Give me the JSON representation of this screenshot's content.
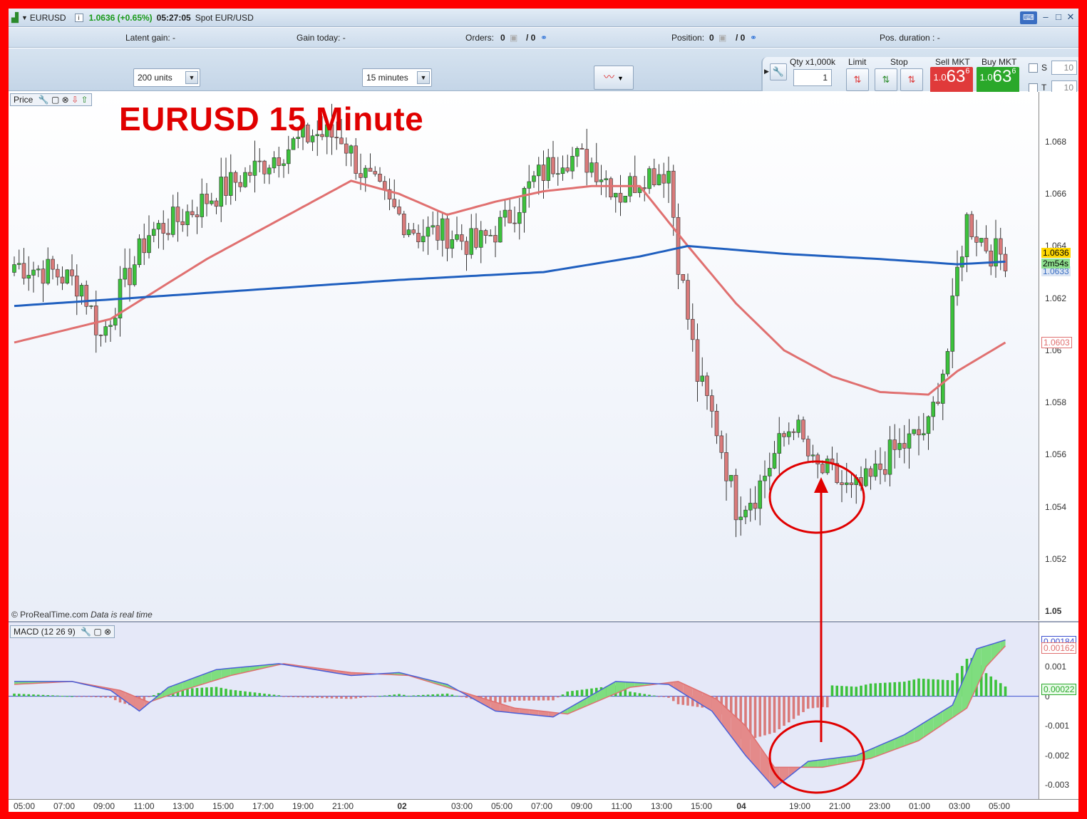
{
  "titlebar": {
    "instrument": "EURUSD",
    "price_change": "1.0636 (+0.65%)",
    "time": "05:27:05",
    "description": "Spot EUR/USD"
  },
  "infobar": {
    "latent_gain": "Latent gain: -",
    "gain_today": "Gain today: -",
    "orders": "Orders:",
    "orders_count": "0",
    "orders_sep": "/ 0",
    "position": "Position:",
    "position_count": "0",
    "position_sep": "/ 0",
    "pos_duration": "Pos. duration : -"
  },
  "toolbar": {
    "units": "200 units",
    "timeframe": "15 minutes",
    "qty_label": "Qty x1,000k",
    "qty_value": "1",
    "limit_label": "Limit",
    "stop_label": "Stop",
    "sell_label": "Sell MKT",
    "buy_label": "Buy MKT",
    "sell_prefix": "1.0",
    "sell_big": "63",
    "sell_sup": "6",
    "buy_prefix": "1.0",
    "buy_big": "63",
    "buy_sup": "6",
    "s_label": "S",
    "t_label": "T",
    "s_value": "10",
    "t_value": "10"
  },
  "price_panel": {
    "label": "Price",
    "title": "EURUSD  15 Minute",
    "copyright": "© ProRealTime.com",
    "realtime": "Data is real time",
    "last_price": "1.0636",
    "countdown": "2m54s",
    "blue_value": "1.0633",
    "red_value": "1.0603",
    "y_ticks": [
      "1.068",
      "1.066",
      "1.064",
      "1.062",
      "1.06",
      "1.058",
      "1.056",
      "1.054",
      "1.052",
      "1.05"
    ]
  },
  "macd_panel": {
    "label": "MACD (12 26 9)",
    "value_macd": "0.00184",
    "value_signal": "0.00162",
    "value_hist": "0.00022",
    "y_ticks": [
      "0.001",
      "0",
      "-0.001",
      "-0.002",
      "-0.003"
    ]
  },
  "x_axis": [
    "05:00",
    "07:00",
    "09:00",
    "11:00",
    "13:00",
    "15:00",
    "17:00",
    "19:00",
    "21:00",
    "02",
    "03:00",
    "05:00",
    "07:00",
    "09:00",
    "11:00",
    "13:00",
    "15:00",
    "04",
    "19:00",
    "21:00",
    "23:00",
    "01:00",
    "03:00",
    "05:00"
  ],
  "colors": {
    "frame": "#ff0000",
    "annotation": "#e00000",
    "ma_slow": "#1f5fbf",
    "ma_fast": "#e07070",
    "up_candle": "#3cc23c",
    "down_candle": "#d97a7a",
    "sell": "#e03a3a",
    "buy": "#2aa82a"
  },
  "chart_data": {
    "type": "candlestick",
    "title": "EURUSD  15 Minute",
    "ylim": [
      1.05,
      1.069
    ],
    "x_labels": [
      "05:00",
      "07:00",
      "09:00",
      "11:00",
      "13:00",
      "15:00",
      "17:00",
      "19:00",
      "21:00",
      "02",
      "03:00",
      "05:00",
      "07:00",
      "09:00",
      "11:00",
      "13:00",
      "15:00",
      "04",
      "19:00",
      "21:00",
      "23:00",
      "01:00",
      "03:00",
      "05:00"
    ],
    "close_path": [
      [
        0,
        1.0633
      ],
      [
        8,
        1.063
      ],
      [
        14,
        1.0625
      ],
      [
        18,
        1.0605
      ],
      [
        22,
        1.0622
      ],
      [
        28,
        1.0645
      ],
      [
        34,
        1.065
      ],
      [
        40,
        1.0658
      ],
      [
        48,
        1.0667
      ],
      [
        56,
        1.0677
      ],
      [
        62,
        1.0683
      ],
      [
        68,
        1.0682
      ],
      [
        72,
        1.0669
      ],
      [
        78,
        1.0655
      ],
      [
        84,
        1.0645
      ],
      [
        90,
        1.0645
      ],
      [
        96,
        1.064
      ],
      [
        102,
        1.0649
      ],
      [
        108,
        1.0665
      ],
      [
        114,
        1.0675
      ],
      [
        120,
        1.0672
      ],
      [
        126,
        1.066
      ],
      [
        131,
        1.0668
      ],
      [
        136,
        1.0669
      ],
      [
        138,
        1.0635
      ],
      [
        142,
        1.059
      ],
      [
        146,
        1.057
      ],
      [
        150,
        1.054
      ],
      [
        154,
        1.0545
      ],
      [
        158,
        1.056
      ],
      [
        162,
        1.0573
      ],
      [
        166,
        1.0555
      ],
      [
        170,
        1.0552
      ],
      [
        174,
        1.0545
      ],
      [
        178,
        1.055
      ],
      [
        182,
        1.056
      ],
      [
        186,
        1.0565
      ],
      [
        190,
        1.057
      ],
      [
        194,
        1.06
      ],
      [
        196,
        1.063
      ],
      [
        198,
        1.065
      ],
      [
        200,
        1.0645
      ],
      [
        203,
        1.0638
      ],
      [
        206,
        1.0636
      ]
    ],
    "ma_fast": {
      "name": "",
      "points": [
        [
          0,
          1.0603
        ],
        [
          20,
          1.0612
        ],
        [
          40,
          1.0635
        ],
        [
          60,
          1.0655
        ],
        [
          70,
          1.0665
        ],
        [
          80,
          1.066
        ],
        [
          90,
          1.0652
        ],
        [
          100,
          1.0657
        ],
        [
          110,
          1.0661
        ],
        [
          120,
          1.0663
        ],
        [
          130,
          1.0663
        ],
        [
          140,
          1.064
        ],
        [
          150,
          1.0618
        ],
        [
          160,
          1.06
        ],
        [
          170,
          1.059
        ],
        [
          180,
          1.0584
        ],
        [
          190,
          1.0583
        ],
        [
          196,
          1.0592
        ],
        [
          206,
          1.0603
        ]
      ]
    },
    "ma_slow": {
      "name": "",
      "points": [
        [
          0,
          1.0617
        ],
        [
          40,
          1.0622
        ],
        [
          80,
          1.0627
        ],
        [
          110,
          1.063
        ],
        [
          130,
          1.0636
        ],
        [
          140,
          1.064
        ],
        [
          160,
          1.0637
        ],
        [
          180,
          1.0635
        ],
        [
          196,
          1.0633
        ],
        [
          206,
          1.0634
        ]
      ]
    },
    "macd": {
      "ylim": [
        -0.0034,
        0.0023
      ],
      "line": [
        [
          0,
          0.0005
        ],
        [
          12,
          0.0005
        ],
        [
          20,
          0.0002
        ],
        [
          26,
          -0.0005
        ],
        [
          32,
          0.0003
        ],
        [
          42,
          0.0009
        ],
        [
          55,
          0.0011
        ],
        [
          70,
          0.0007
        ],
        [
          80,
          0.0008
        ],
        [
          90,
          0.0004
        ],
        [
          100,
          -0.0005
        ],
        [
          112,
          -0.0007
        ],
        [
          125,
          0.0005
        ],
        [
          136,
          0.0004
        ],
        [
          145,
          -0.0005
        ],
        [
          152,
          -0.002
        ],
        [
          158,
          -0.0031
        ],
        [
          165,
          -0.0022
        ],
        [
          175,
          -0.002
        ],
        [
          185,
          -0.0013
        ],
        [
          195,
          -0.0003
        ],
        [
          200,
          0.0016
        ],
        [
          206,
          0.0019
        ]
      ],
      "signal": [
        [
          0,
          0.0004
        ],
        [
          12,
          0.0005
        ],
        [
          22,
          0.0002
        ],
        [
          28,
          -0.0002
        ],
        [
          35,
          0.0002
        ],
        [
          45,
          0.0007
        ],
        [
          56,
          0.0011
        ],
        [
          70,
          0.0008
        ],
        [
          82,
          0.0007
        ],
        [
          92,
          0.0002
        ],
        [
          104,
          -0.0004
        ],
        [
          115,
          -0.0006
        ],
        [
          128,
          0.0003
        ],
        [
          138,
          0.0005
        ],
        [
          146,
          -0.0001
        ],
        [
          152,
          -0.001
        ],
        [
          158,
          -0.0024
        ],
        [
          168,
          -0.0024
        ],
        [
          178,
          -0.0021
        ],
        [
          188,
          -0.0015
        ],
        [
          198,
          -0.0004
        ],
        [
          202,
          0.001
        ],
        [
          206,
          0.0017
        ]
      ],
      "histogram_values": "difference of macd line and signal line"
    }
  }
}
